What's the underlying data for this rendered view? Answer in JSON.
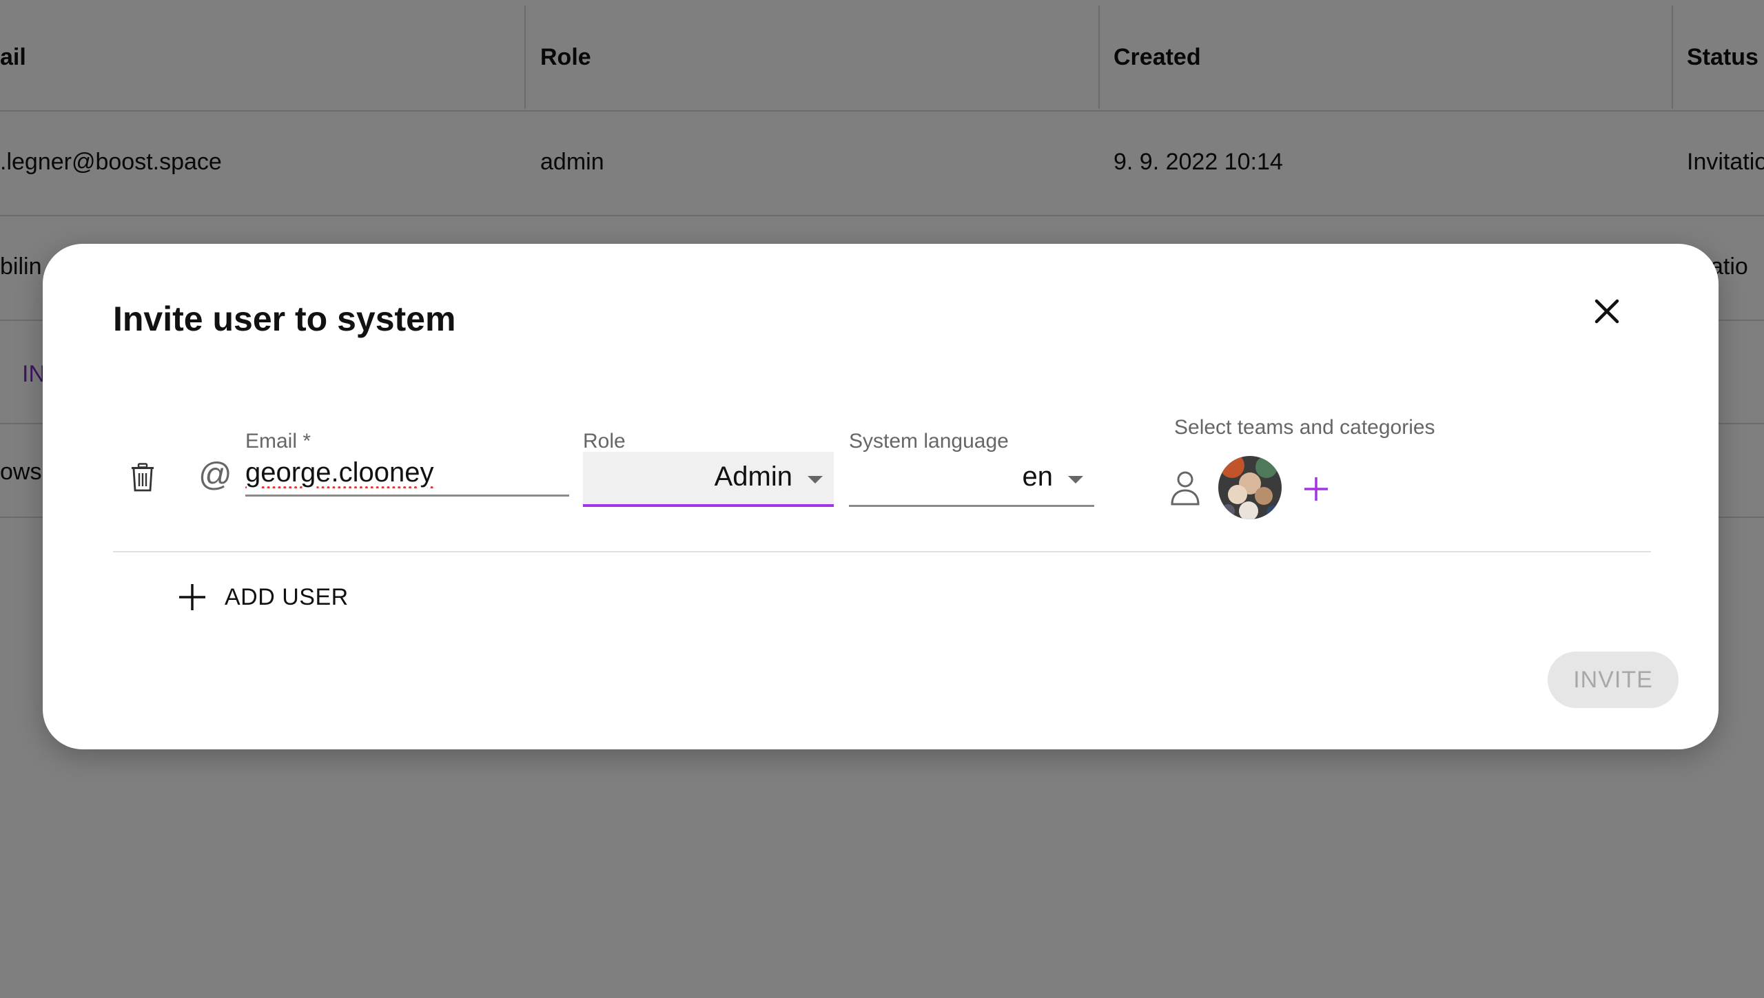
{
  "table": {
    "headers": [
      "ail",
      "Role",
      "Created",
      "Status"
    ],
    "rows": [
      {
        "email": ".legner@boost.space",
        "role": "admin",
        "created": "9. 9. 2022 10:14",
        "status": "Invitatio"
      },
      {
        "email": "bilin",
        "status": "vitatio"
      }
    ],
    "invite_fragment": "IN",
    "rows_fragment": "ows"
  },
  "modal": {
    "title": "Invite user to system",
    "close_icon": "close-icon",
    "user_row": {
      "delete_icon": "trash-icon",
      "email_icon": "at-icon",
      "email_label": "Email *",
      "email_value": "george.clooney",
      "role_label": "Role",
      "role_value": "Admin",
      "language_label": "System language",
      "language_value": "en",
      "teams_label": "Select teams and categories",
      "user_icon": "person-icon",
      "add_team_icon": "plus-icon"
    },
    "add_user_label": "ADD USER",
    "invite_label": "INVITE"
  },
  "colors": {
    "accent": "#a034e6",
    "link_purple": "#7b2cbf",
    "overlay": "rgba(0,0,0,0.5)",
    "disabled_bg": "#e6e6e6",
    "disabled_text": "#a8a8a8"
  }
}
